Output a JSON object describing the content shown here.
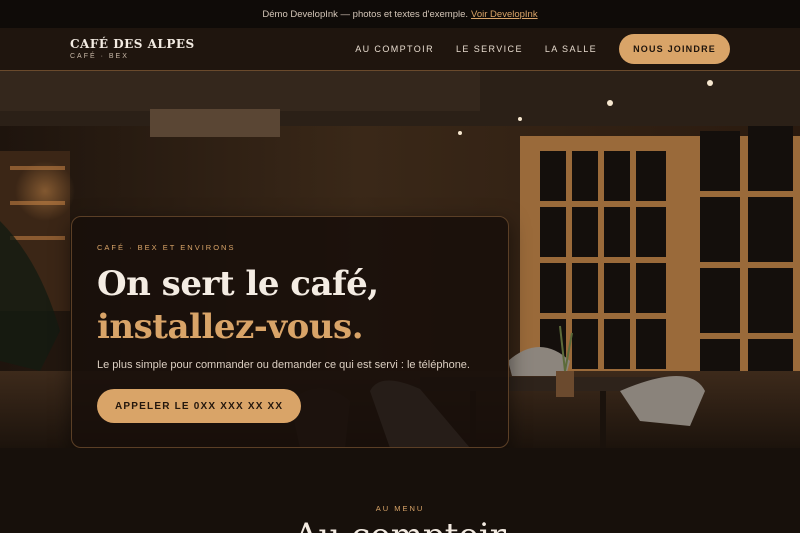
{
  "demo_bar": {
    "text": "Démo DevelopInk — photos et textes d'exemple.",
    "link": "Voir DevelopInk"
  },
  "brand": {
    "name": "CAFÉ DES ALPES",
    "tagline": "CAFÉ · BEX"
  },
  "nav": {
    "items": [
      "AU COMPTOIR",
      "LE SERVICE",
      "LA SALLE"
    ],
    "cta": "NOUS JOINDRE"
  },
  "hero": {
    "eyebrow": "CAFÉ · BEX ET ENVIRONS",
    "headline_line1": "On sert le café,",
    "headline_line2": "installez-vous.",
    "lead": "Le plus simple pour commander ou demander ce qui est servi : le téléphone.",
    "cta": "APPELER LE 0XX XXX XX XX"
  },
  "menu": {
    "eyebrow": "AU MENU",
    "title": "Au comptoir"
  },
  "colors": {
    "accent": "#d9a468",
    "background": "#17100b",
    "header": "#1f150e"
  }
}
